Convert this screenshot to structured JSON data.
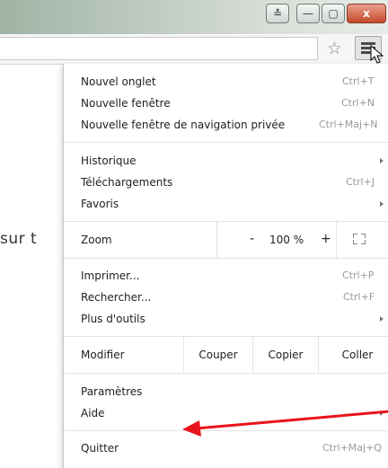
{
  "window": {
    "buttons": {
      "user": "≛",
      "minimize": "—",
      "maximize": "▢",
      "close": "x"
    }
  },
  "toolbar": {
    "bookmark_icon": "☆"
  },
  "page": {
    "partial_text": "sur t"
  },
  "menu": {
    "new_tab": {
      "label": "Nouvel onglet",
      "shortcut": "Ctrl+T"
    },
    "new_window": {
      "label": "Nouvelle fenêtre",
      "shortcut": "Ctrl+N"
    },
    "incognito": {
      "label": "Nouvelle fenêtre de navigation privée",
      "shortcut": "Ctrl+Maj+N"
    },
    "history": {
      "label": "Historique"
    },
    "downloads": {
      "label": "Téléchargements",
      "shortcut": "Ctrl+J"
    },
    "bookmarks": {
      "label": "Favoris"
    },
    "zoom": {
      "label": "Zoom",
      "minus": "-",
      "value": "100 %",
      "plus": "+"
    },
    "print": {
      "label": "Imprimer...",
      "shortcut": "Ctrl+P"
    },
    "find": {
      "label": "Rechercher...",
      "shortcut": "Ctrl+F"
    },
    "more_tools": {
      "label": "Plus d'outils"
    },
    "edit": {
      "label": "Modifier",
      "cut": "Couper",
      "copy": "Copier",
      "paste": "Coller"
    },
    "settings": {
      "label": "Paramètres"
    },
    "help": {
      "label": "Aide"
    },
    "quit": {
      "label": "Quitter",
      "shortcut": "Ctrl+Maj+Q"
    }
  },
  "annotation": {
    "arrow_color": "#e8141b"
  }
}
